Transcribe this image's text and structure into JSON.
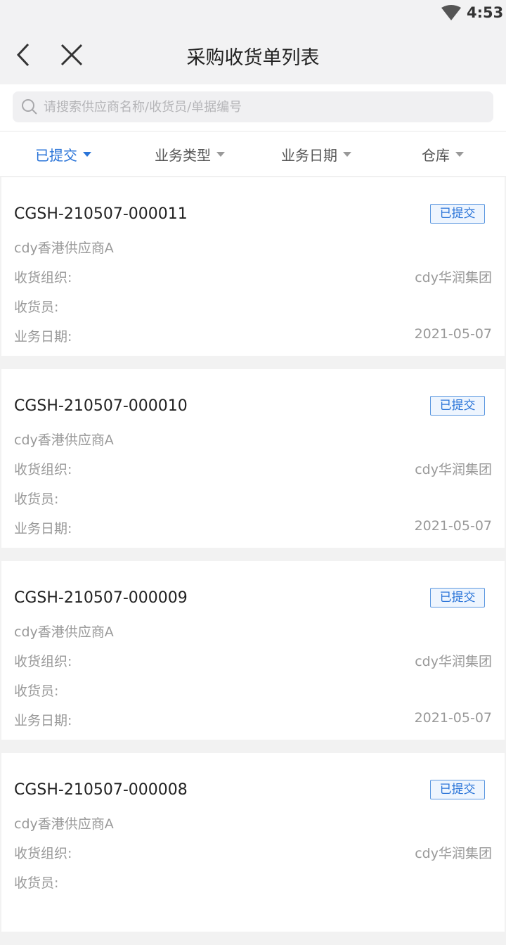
{
  "status_bar": {
    "time": "4:53"
  },
  "header": {
    "title": "采购收货单列表"
  },
  "search": {
    "placeholder": "请搜索供应商名称/收货员/单据编号"
  },
  "filters": [
    {
      "label": "已提交",
      "active": true
    },
    {
      "label": "业务类型",
      "active": false
    },
    {
      "label": "业务日期",
      "active": false
    },
    {
      "label": "仓库",
      "active": false
    }
  ],
  "labels": {
    "org": "收货组织:",
    "receiver": "收货员:",
    "date": "业务日期:"
  },
  "records": [
    {
      "doc_no": "CGSH-210507-000011",
      "status": "已提交",
      "supplier": "cdy香港供应商A",
      "org": "cdy华润集团",
      "receiver": "",
      "date": "2021-05-07"
    },
    {
      "doc_no": "CGSH-210507-000010",
      "status": "已提交",
      "supplier": "cdy香港供应商A",
      "org": "cdy华润集团",
      "receiver": "",
      "date": "2021-05-07"
    },
    {
      "doc_no": "CGSH-210507-000009",
      "status": "已提交",
      "supplier": "cdy香港供应商A",
      "org": "cdy华润集团",
      "receiver": "",
      "date": "2021-05-07"
    },
    {
      "doc_no": "CGSH-210507-000008",
      "status": "已提交",
      "supplier": "cdy香港供应商A",
      "org": "cdy华润集团",
      "receiver": "",
      "date": ""
    }
  ],
  "colors": {
    "accent": "#2a74d8",
    "muted": "#999999"
  }
}
